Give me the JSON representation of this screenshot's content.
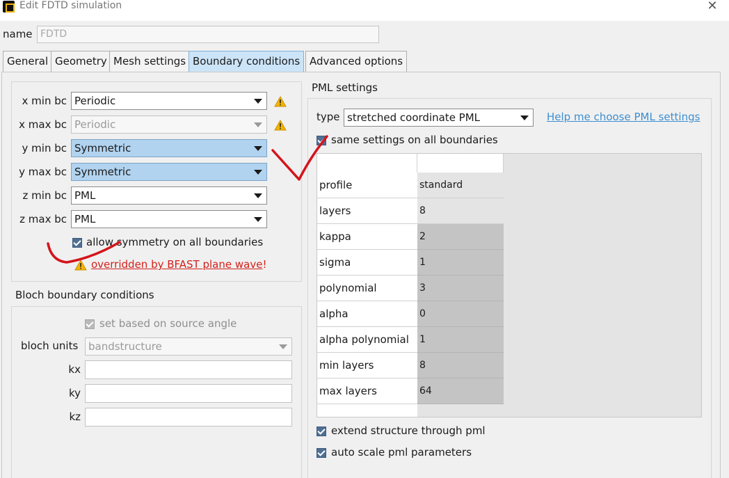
{
  "window": {
    "title": "Edit FDTD simulation",
    "close_glyph": "✕"
  },
  "name_field": {
    "label": "name",
    "value": "FDTD"
  },
  "tabs": [
    {
      "label": "General",
      "active": false
    },
    {
      "label": "Geometry",
      "active": false
    },
    {
      "label": "Mesh settings",
      "active": false
    },
    {
      "label": "Boundary conditions",
      "active": true
    },
    {
      "label": "Advanced options",
      "active": false
    }
  ],
  "boundary": {
    "rows": [
      {
        "label": "x min bc",
        "value": "Periodic",
        "state": "normal",
        "warning": true
      },
      {
        "label": "x max bc",
        "value": "Periodic",
        "state": "disabled",
        "warning": true
      },
      {
        "label": "y min bc",
        "value": "Symmetric",
        "state": "selected",
        "warning": false
      },
      {
        "label": "y max bc",
        "value": "Symmetric",
        "state": "selected",
        "warning": false
      },
      {
        "label": "z min bc",
        "value": "PML",
        "state": "normal",
        "warning": false
      },
      {
        "label": "z max bc",
        "value": "PML",
        "state": "normal",
        "warning": false
      }
    ],
    "allow_symmetry": {
      "label": "allow symmetry on all boundaries",
      "checked": true
    },
    "override_link": "overridden by BFAST plane wave",
    "override_suffix": "!"
  },
  "bloch": {
    "title": "Bloch boundary conditions",
    "set_based": {
      "label": "set based on source angle",
      "checked": true,
      "enabled": false
    },
    "units_label": "bloch units",
    "units_value": "bandstructure",
    "kx_label": "kx",
    "ky_label": "ky",
    "kz_label": "kz",
    "kx_value": "",
    "ky_value": "",
    "kz_value": ""
  },
  "pml": {
    "title": "PML settings",
    "type_label": "type",
    "type_value": "stretched coordinate PML",
    "help_link": "Help me choose PML settings",
    "same_settings": {
      "label": "same settings on all boundaries",
      "checked": true
    },
    "table": [
      {
        "key": "profile",
        "value": "standard",
        "shade": "light"
      },
      {
        "key": "layers",
        "value": "8",
        "shade": "light"
      },
      {
        "key": "kappa",
        "value": "2",
        "shade": "dark"
      },
      {
        "key": "sigma",
        "value": "1",
        "shade": "dark"
      },
      {
        "key": "polynomial",
        "value": "3",
        "shade": "dark"
      },
      {
        "key": "alpha",
        "value": "0",
        "shade": "dark"
      },
      {
        "key": "alpha polynomial",
        "value": "1",
        "shade": "dark"
      },
      {
        "key": "min layers",
        "value": "8",
        "shade": "dark"
      },
      {
        "key": "max layers",
        "value": "64",
        "shade": "dark"
      }
    ],
    "extend_structure": {
      "label": "extend structure through pml",
      "checked": true
    },
    "auto_scale": {
      "label": "auto scale pml parameters",
      "checked": true
    }
  },
  "colors": {
    "accent_selected": "#b1d3ef",
    "tab_active": "#cce4f7",
    "checkbox": "#4f6f94",
    "warning": "#f4b400",
    "error_link": "#d3201a",
    "help_link": "#3c8fd0",
    "annotation": "#d4141b"
  }
}
